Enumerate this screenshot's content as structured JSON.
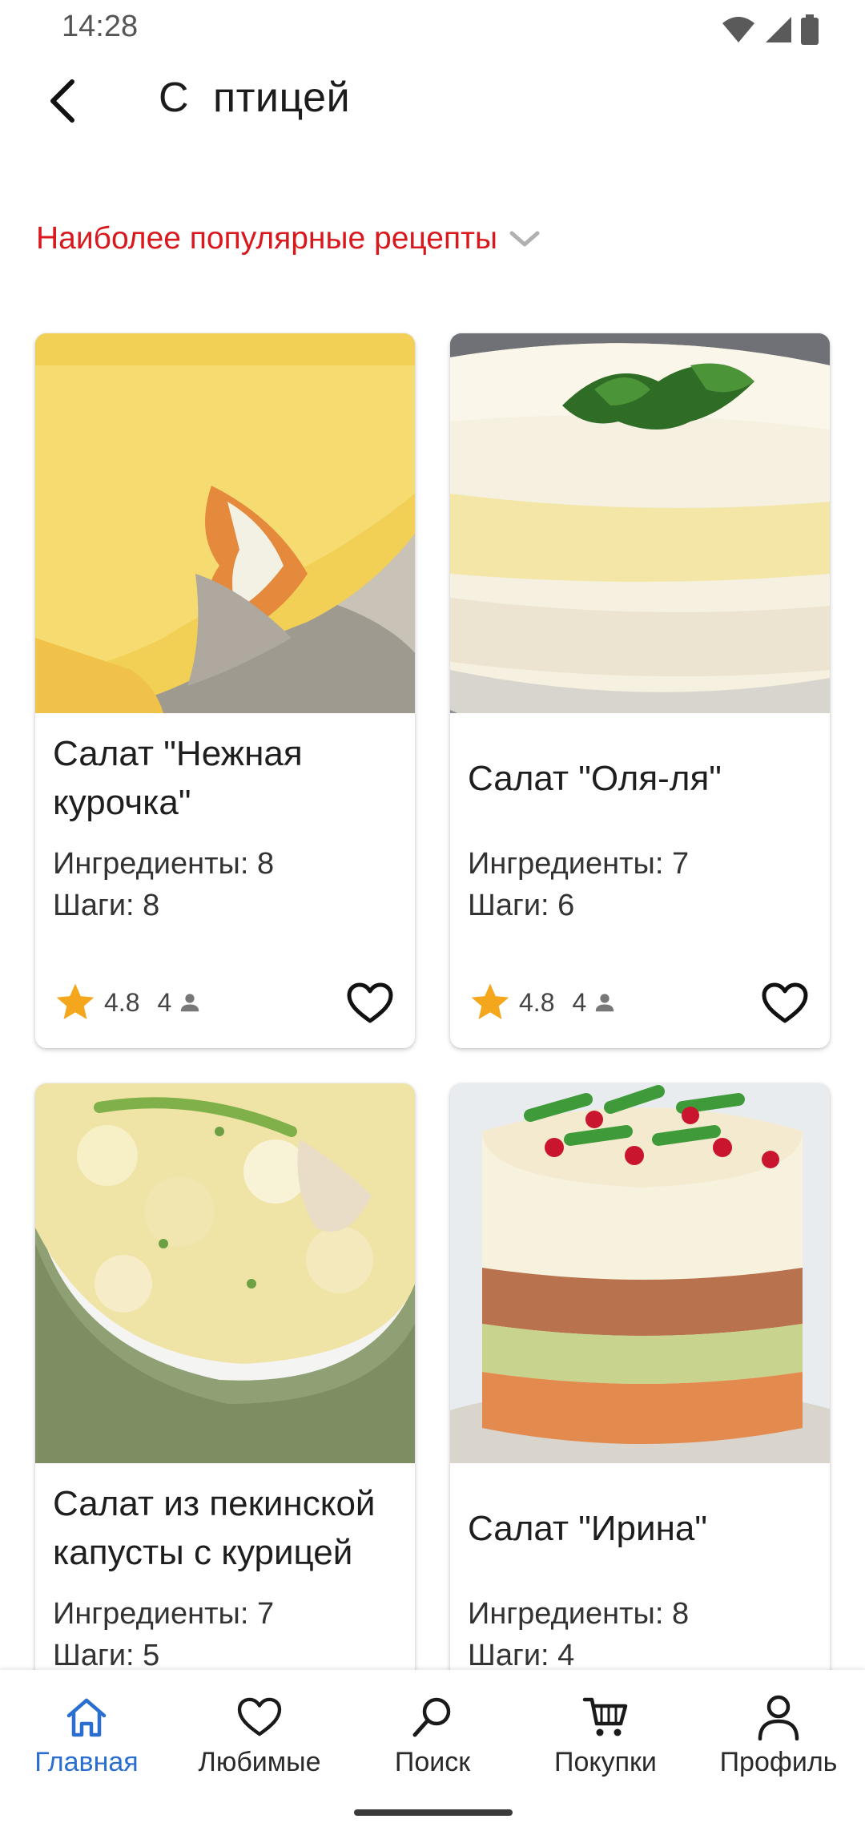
{
  "status_bar": {
    "time": "14:28"
  },
  "header": {
    "title": "С  птицей"
  },
  "sort": {
    "label": "Наиболее популярные рецепты"
  },
  "colors": {
    "accent": "#d9181d",
    "nav_active": "#2a6fd0",
    "star": "#f4a61c"
  },
  "recipes": [
    {
      "title": "Салат \"Нежная курочка\"",
      "ingredients": "Ингредиенты: 8",
      "steps": "Шаги: 8",
      "rating": "4.8",
      "reviews": "4"
    },
    {
      "title": "Салат \"Оля-ля\"",
      "ingredients": "Ингредиенты: 7",
      "steps": "Шаги: 6",
      "rating": "4.8",
      "reviews": "4"
    },
    {
      "title": "Салат из пекинской капусты с курицей",
      "ingredients": "Ингредиенты: 7",
      "steps": "Шаги: 5",
      "rating": "",
      "reviews": ""
    },
    {
      "title": "Салат \"Ирина\"",
      "ingredients": "Ингредиенты: 8",
      "steps": "Шаги: 4",
      "rating": "",
      "reviews": ""
    }
  ],
  "nav": [
    {
      "label": "Главная",
      "icon": "home-icon",
      "active": true
    },
    {
      "label": "Любимые",
      "icon": "heart-icon",
      "active": false
    },
    {
      "label": "Поиск",
      "icon": "search-icon",
      "active": false
    },
    {
      "label": "Покупки",
      "icon": "cart-icon",
      "active": false
    },
    {
      "label": "Профиль",
      "icon": "profile-icon",
      "active": false
    }
  ]
}
